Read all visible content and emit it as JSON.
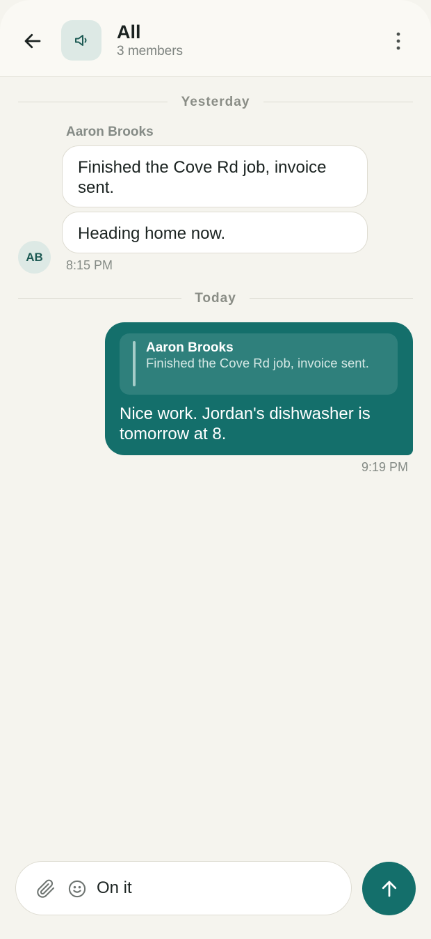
{
  "header": {
    "title": "All",
    "subtitle": "3 members",
    "back_icon": "arrow-left-icon",
    "group_icon": "megaphone-icon",
    "menu_icon": "more-vertical-icon"
  },
  "dividers": {
    "yesterday": "Yesterday",
    "today": "Today"
  },
  "incoming": {
    "sender": "Aaron Brooks",
    "avatar_initials": "AB",
    "messages": [
      "Finished the Cove Rd job, invoice sent.",
      "Heading home now."
    ],
    "time": "8:15 PM"
  },
  "outgoing": {
    "reply_to": {
      "author": "Aaron Brooks",
      "text": "Finished the Cove Rd job, invoice sent."
    },
    "text": "Nice work. Jordan's dishwasher is tomorrow at 8.",
    "time": "9:19 PM"
  },
  "composer": {
    "value": "On it",
    "attach_icon": "paperclip-icon",
    "emoji_icon": "smiley-icon",
    "send_icon": "arrow-up-icon"
  },
  "colors": {
    "accent": "#146f6b",
    "background": "#f5f4ee",
    "header_background": "#faf9f4",
    "incoming_bubble": "#ffffff",
    "avatar_tint": "#dde9e5"
  }
}
